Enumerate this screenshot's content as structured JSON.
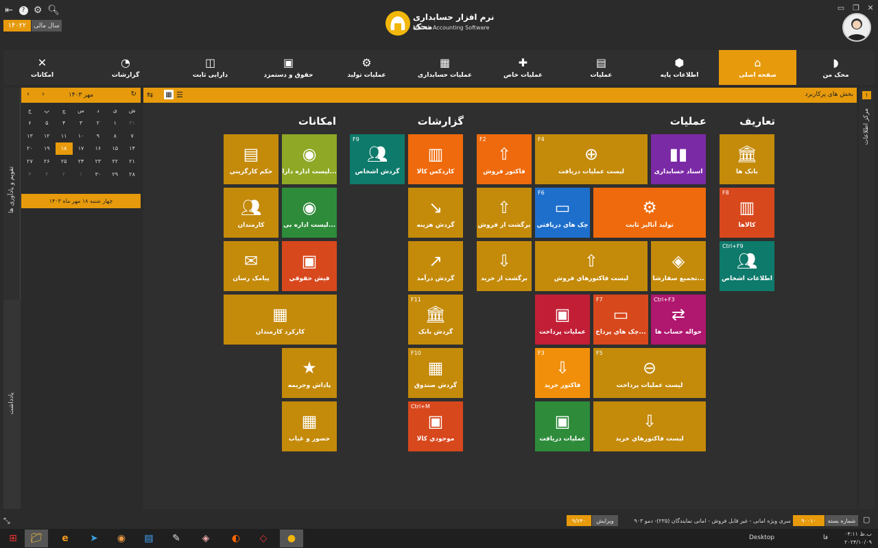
{
  "app": {
    "title_fa": "نرم افزار حسابداری محک",
    "title_en": "Mohak Accounting Software",
    "fiscal_year_label": "سال مالی",
    "fiscal_year_value": "۱۴۰۲۲"
  },
  "menu": [
    {
      "label": "محک من",
      "icon": "mohak-icon"
    },
    {
      "label": "صفحه اصلی",
      "icon": "home-icon",
      "active": true
    },
    {
      "label": "اطلاعات پایه",
      "icon": "cube-icon"
    },
    {
      "label": "عملیات",
      "icon": "cash-register-icon"
    },
    {
      "label": "عملیات خاص",
      "icon": "puzzle-icon"
    },
    {
      "label": "عملیات حسابداری",
      "icon": "calculator-icon"
    },
    {
      "label": "عملیات تولید",
      "icon": "production-icon"
    },
    {
      "label": "حقوق و دستمزد",
      "icon": "payroll-icon"
    },
    {
      "label": "دارایی ثابت",
      "icon": "asset-icon"
    },
    {
      "label": "گزارشات",
      "icon": "reports-icon"
    },
    {
      "label": "امکانات",
      "icon": "tools-icon"
    }
  ],
  "left_panel": {
    "tab_calendar": "تقویم و یادآوری ها",
    "tab_notes": "یادداشت",
    "calendar": {
      "month_label": "مهر ۱۴۰۳",
      "weekdays": [
        "ش",
        "ی",
        "د",
        "س",
        "چ",
        "پ",
        "ج"
      ],
      "rows": [
        [
          "۳۱",
          "۱",
          "۲",
          "۳",
          "۴",
          "۵",
          "۶"
        ],
        [
          "۷",
          "۸",
          "۹",
          "۱۰",
          "۱۱",
          "۱۲",
          "۱۳"
        ],
        [
          "۱۴",
          "۱۵",
          "۱۶",
          "۱۷",
          "۱۸",
          "۱۹",
          "۲۰"
        ],
        [
          "۲۱",
          "۲۲",
          "۲۳",
          "۲۴",
          "۲۵",
          "۲۶",
          "۲۷"
        ],
        [
          "۲۸",
          "۲۹",
          "۳۰",
          "۱",
          "۲",
          "۳",
          "۴"
        ]
      ],
      "selected": "۱۸",
      "today_text": "چهار شنبه ۱۸ مهر ماه ۱۴۰۳"
    }
  },
  "main": {
    "header": "بخش های پرکاربرد",
    "right_tab": "مرکز اطلاعات",
    "sections": {
      "definitions": "تعاریف",
      "operations": "عملیات",
      "reports": "گزارشات",
      "features": "امکانات"
    },
    "tiles": [
      {
        "label": "بانک ها",
        "key": "",
        "color": "#c48a0a",
        "icon": "bank-icon"
      },
      {
        "label": "کالاها",
        "key": "F8",
        "color": "#d8481d",
        "icon": "goods-icon"
      },
      {
        "label": "اطلاعات اشخاص",
        "key": "Ctrl+F9",
        "color": "#0e7a6b",
        "icon": "people-icon"
      },
      {
        "label": "اسناد حسابداری",
        "key": "",
        "color": "#7b2aa5",
        "icon": "docs-icon"
      },
      {
        "label": "لیست عملیات دریافت",
        "key": "F4",
        "color": "#c48a0a",
        "icon": "receipt-list-icon"
      },
      {
        "label": "فاکتور فروش",
        "key": "F2",
        "color": "#ef6a0c",
        "icon": "sale-basket-icon"
      },
      {
        "label": "تولید آنالیز ثابت",
        "key": "",
        "color": "#ef6a0c",
        "icon": "gear-icon"
      },
      {
        "label": "چک هاي دريافتي",
        "key": "F6",
        "color": "#1e6fcc",
        "icon": "check-icon"
      },
      {
        "label": "برگشت از فروش",
        "key": "",
        "color": "#c48a0a",
        "icon": "return-sale-icon"
      },
      {
        "label": "تجمیع سفارشا...",
        "key": "",
        "color": "#c48a0a",
        "icon": "merge-icon"
      },
      {
        "label": "لیست فاکتورهاي فروش",
        "key": "",
        "color": "#c48a0a",
        "icon": "sale-list-icon"
      },
      {
        "label": "برگشت از خريد",
        "key": "",
        "color": "#c48a0a",
        "icon": "return-buy-icon"
      },
      {
        "label": "حواله حساب ها",
        "key": "Ctrl+F3",
        "color": "#b0176e",
        "icon": "transfer-icon"
      },
      {
        "label": "چک هاي پرداخ...",
        "key": "F7",
        "color": "#d8481d",
        "icon": "pay-check-icon"
      },
      {
        "label": "عمليات پرداخت",
        "key": "",
        "color": "#c21f36",
        "icon": "payment-icon"
      },
      {
        "label": "لیست عملیات پرداخت",
        "key": "F5",
        "color": "#c48a0a",
        "icon": "payment-list-icon"
      },
      {
        "label": "فاكتور خريد",
        "key": "F3",
        "color": "#f28f0a",
        "icon": "buy-basket-icon"
      },
      {
        "label": "لیست فاکتورهاي خرید",
        "key": "",
        "color": "#c48a0a",
        "icon": "buy-list-icon"
      },
      {
        "label": "عمليات دريافت",
        "key": "",
        "color": "#2e8b3a",
        "icon": "receive-icon"
      },
      {
        "label": "کاردکس کالا",
        "key": "",
        "color": "#ef6a0c",
        "icon": "cardex-icon"
      },
      {
        "label": "گردش اشخاص",
        "key": "F9",
        "color": "#0e7a6b",
        "icon": "people-flow-icon"
      },
      {
        "label": "گردش هزینه",
        "key": "",
        "color": "#c48a0a",
        "icon": "expense-icon"
      },
      {
        "label": "گردش درآمد",
        "key": "",
        "color": "#c48a0a",
        "icon": "income-icon"
      },
      {
        "label": "گردش بانک",
        "key": "F11",
        "color": "#c48a0a",
        "icon": "bank-flow-icon"
      },
      {
        "label": "گردش صندوق",
        "key": "F10",
        "color": "#c48a0a",
        "icon": "cashbox-icon"
      },
      {
        "label": "موجودي كالا",
        "key": "Ctrl+M",
        "color": "#d8481d",
        "icon": "stock-icon"
      },
      {
        "label": "لیست اداره دارا...",
        "key": "",
        "color": "#8fa826",
        "icon": "asset-list-icon"
      },
      {
        "label": "حکم کارگزيني",
        "key": "",
        "color": "#c48a0a",
        "icon": "decree-icon"
      },
      {
        "label": "لیست اداره بی...",
        "key": "",
        "color": "#2e8b3a",
        "icon": "insurance-list-icon"
      },
      {
        "label": "کارمندان",
        "key": "",
        "color": "#c48a0a",
        "icon": "staff-icon"
      },
      {
        "label": "فیش حقوقي",
        "key": "",
        "color": "#d8481d",
        "icon": "payslip-icon"
      },
      {
        "label": "پیامک رسان",
        "key": "",
        "color": "#c48a0a",
        "icon": "sms-icon"
      },
      {
        "label": "کارکرد کارمندان",
        "key": "",
        "color": "#c48a0a",
        "icon": "attendance-icon"
      },
      {
        "label": "پاداش وجريمه",
        "key": "",
        "color": "#c48a0a",
        "icon": "reward-icon"
      },
      {
        "label": "حضور و غیاب",
        "key": "",
        "color": "#c48a0a",
        "icon": "presence-icon"
      }
    ]
  },
  "status": {
    "package_label": "شماره بسته",
    "package_value": "۹۰۰۱۰",
    "series_text": "سری ویژه امانی - غیر قابل فروش - امانی نمایندگان (۲۳۵)- دمو ۹۰۳",
    "version_label": "ویرایش",
    "version_value": "۹/۶۴۰"
  },
  "taskbar": {
    "desktop": "Desktop",
    "lang": "فا",
    "time": "۰۴:۱۱ ب.ظ",
    "date": "۲۰۲۴/۱۰/۰۹"
  },
  "colors": {
    "accent": "#e69a0c",
    "bg": "#2b2b2b",
    "panel": "#2f2f2f"
  }
}
